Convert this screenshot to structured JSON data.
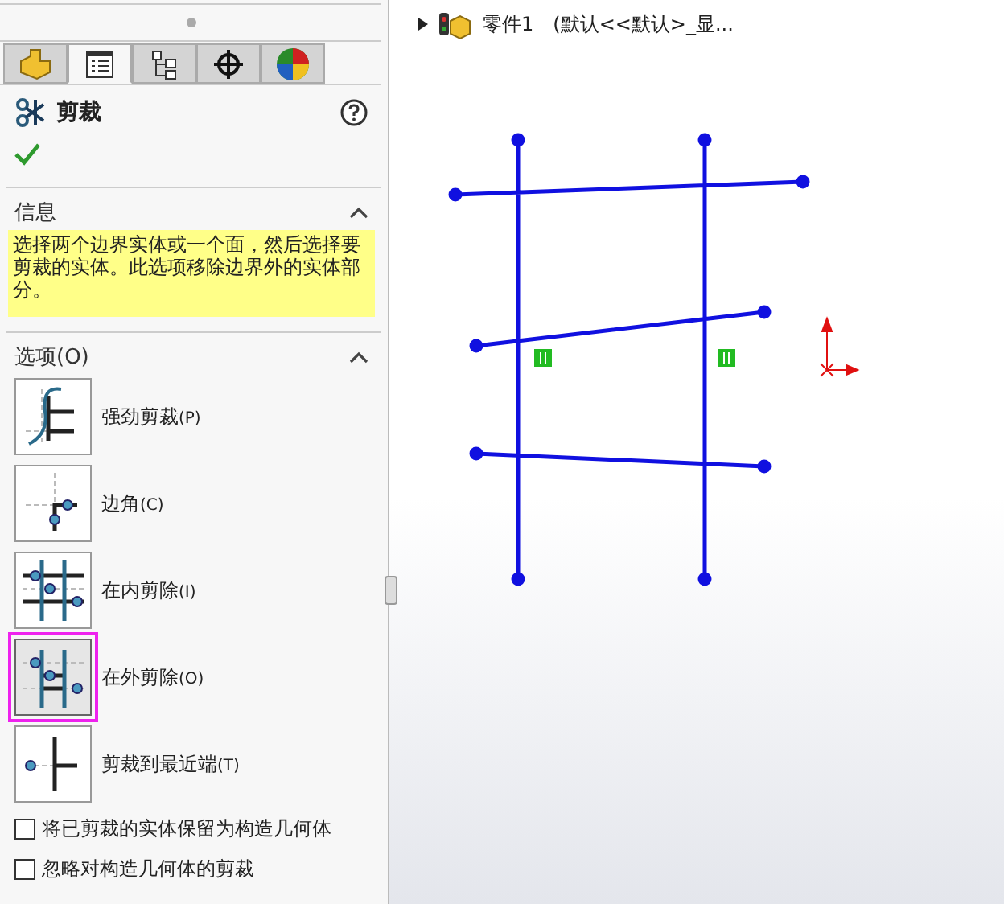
{
  "panel": {
    "tabs": [
      {
        "selected": false
      },
      {
        "selected": true
      },
      {
        "selected": false
      },
      {
        "selected": false
      },
      {
        "selected": false
      }
    ],
    "title": "剪裁",
    "info": {
      "heading": "信息",
      "text": "选择两个边界实体或一个面，然后选择要剪裁的实体。此选项移除边界外的实体部分。"
    },
    "options": {
      "heading": "选项(O)",
      "items": [
        {
          "label": "强劲剪裁",
          "key": "(P)",
          "selected": false
        },
        {
          "label": "边角",
          "key": "(C)",
          "selected": false
        },
        {
          "label": "在内剪除",
          "key": "(I)",
          "selected": false
        },
        {
          "label": "在外剪除",
          "key": "(O)",
          "selected": true
        },
        {
          "label": "剪裁到最近端",
          "key": "(T)",
          "selected": false
        }
      ]
    },
    "checkboxes": [
      {
        "label": "将已剪裁的实体保留为构造几何体",
        "checked": false
      },
      {
        "label": "忽略对构造几何体的剪裁",
        "checked": false
      }
    ]
  },
  "tree": {
    "name": "零件1",
    "config": "(默认<<默认>_显..."
  }
}
